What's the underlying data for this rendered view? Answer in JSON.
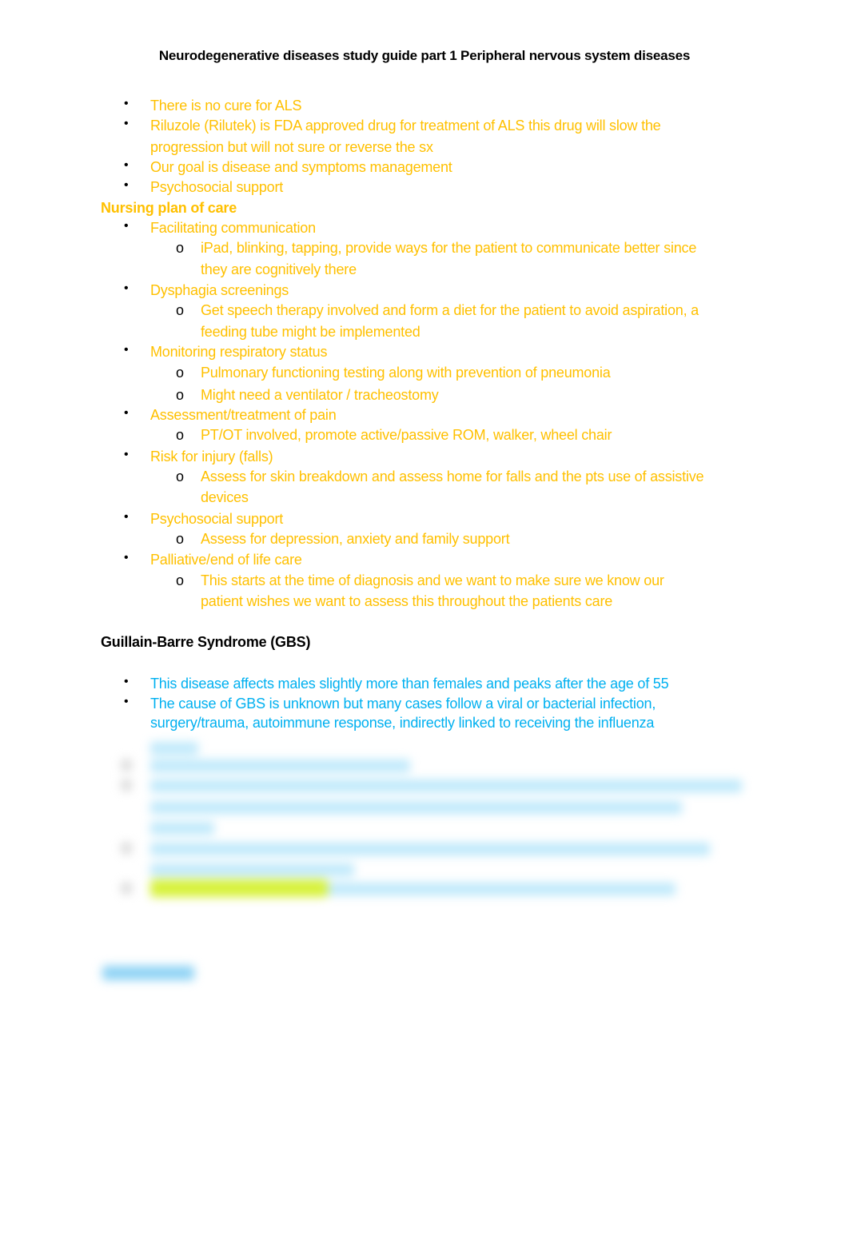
{
  "document": {
    "title": "Neurodegenerative diseases study guide part 1 Peripheral nervous system diseases",
    "colors": {
      "highlight_yellow": "#ffc000",
      "highlight_blue": "#00b0f0",
      "heading": "#000000"
    },
    "als_bullets": [
      "There is no cure for ALS",
      "Riluzole (Rilutek) is FDA approved drug for treatment of ALS this drug will slow the",
      "progression but will not sure or reverse the sx",
      "Our goal is disease and symptoms management",
      "Psychosocial support"
    ],
    "nursing_plan": {
      "heading": "Nursing plan of care",
      "items": [
        {
          "label": "Facilitating communication",
          "sub": [
            "iPad, blinking, tapping, provide ways for the patient to communicate better since",
            "they are cognitively there"
          ]
        },
        {
          "label": "Dysphagia screenings",
          "sub": [
            "Get speech therapy involved and form a diet for the patient to avoid aspiration, a",
            "feeding tube might be implemented"
          ]
        },
        {
          "label": "Monitoring respiratory status",
          "sub": [
            "Pulmonary functioning testing along with prevention of pneumonia",
            "Might need a ventilator / tracheostomy"
          ]
        },
        {
          "label": "Assessment/treatment of pain",
          "sub": [
            "PT/OT involved, promote active/passive ROM, walker, wheel chair"
          ]
        },
        {
          "label": "Risk for injury (falls)",
          "sub": [
            "Assess for skin breakdown and assess home for falls and the pts use of assistive",
            "devices"
          ]
        },
        {
          "label": "Psychosocial support",
          "sub": [
            "Assess for depression, anxiety and family support"
          ]
        },
        {
          "label": "Palliative/end of life care",
          "sub": [
            "This starts at the time of diagnosis and we want to make sure we know our",
            "patient wishes we want to assess this throughout the patients care"
          ]
        }
      ]
    },
    "gbs": {
      "heading": "Guillain-Barre Syndrome (GBS)",
      "bullets": [
        "This disease affects males slightly more than females and peaks after the age of 55",
        "The cause of GBS is unknown but many cases follow a viral or bacterial infection,",
        "surgery/trauma, autoimmune response, indirectly linked to receiving the influenza"
      ]
    },
    "bullet_glyph": "•",
    "sub_bullet_glyph": "o"
  }
}
